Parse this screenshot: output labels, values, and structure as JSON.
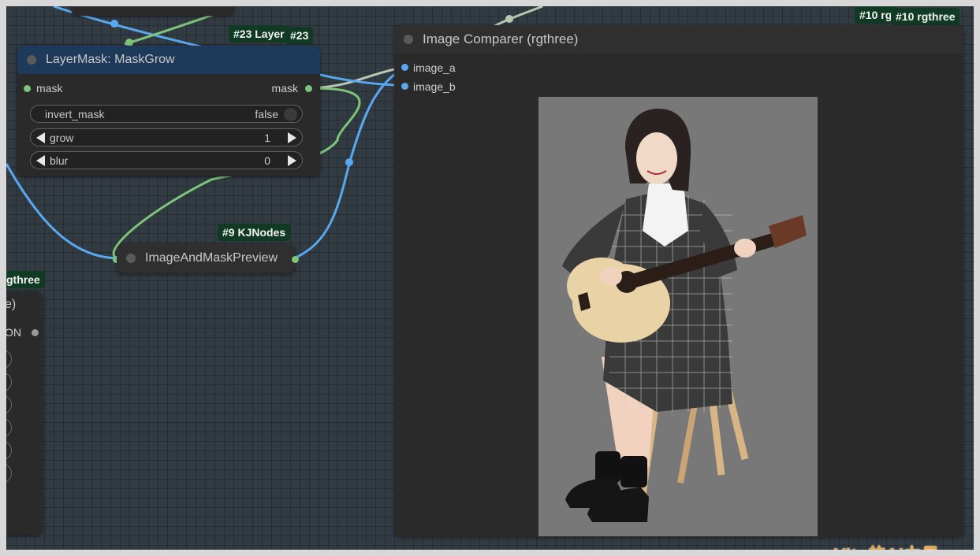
{
  "colors": {
    "canvas_bg": "#323a42",
    "node_bg": "#2a2a2a",
    "node_header_blue": "#1d3a5a",
    "badge_bg": "#113a25",
    "link_mask_green": "#7cc47a",
    "link_image_blue": "#58a8f0",
    "link_gray": "#b8c8b0"
  },
  "top_node": {
    "label": ""
  },
  "layermask_node": {
    "badge_back": "#23 Layer",
    "badge_front": "#23",
    "title": "LayerMask: MaskGrow",
    "input_label": "mask",
    "output_label": "mask",
    "widgets": [
      {
        "name": "invert_mask",
        "value": "false"
      },
      {
        "name": "grow",
        "value": "1"
      },
      {
        "name": "blur",
        "value": "0"
      }
    ]
  },
  "preview_node": {
    "badge": "#9 KJNodes",
    "title": "ImageAndMaskPreview"
  },
  "left_partial_node": {
    "badge": "gthree",
    "title_fragment": "e)",
    "output_label": "ON",
    "arrow_buttons": 6
  },
  "comparer_node": {
    "badge_back": "#10 rg",
    "badge_front": "#10 rgthree",
    "title": "Image Comparer (rgthree)",
    "inputs": [
      "image_a",
      "image_b"
    ],
    "preview": {
      "subject": "woman-with-acoustic-guitar-on-wooden-stool",
      "background_color": "#787878"
    }
  },
  "watermark": {
    "text": "Vito的AI力量"
  },
  "icons": {
    "arrow_button_icon": "right-arrow-icon",
    "dec_icon": "triangle-left-icon",
    "inc_icon": "triangle-right-icon"
  }
}
